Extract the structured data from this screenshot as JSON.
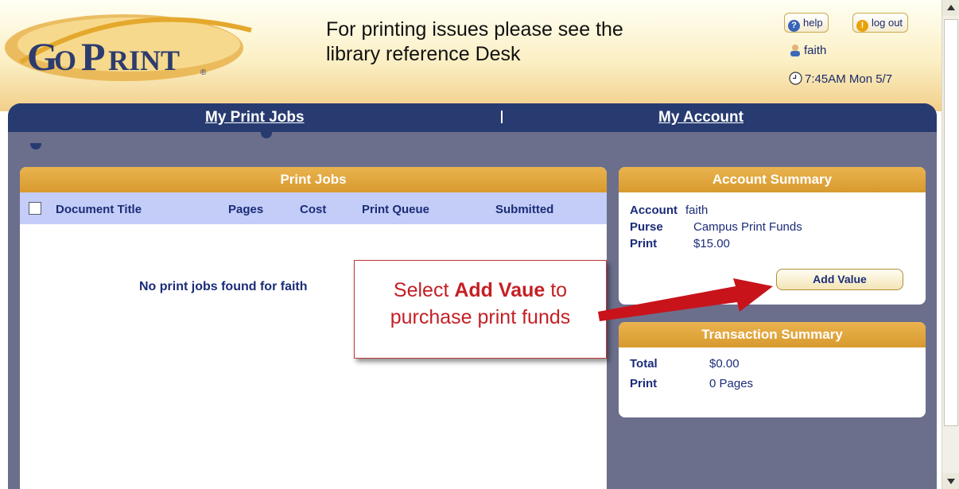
{
  "header": {
    "logo_text": "GoPrint",
    "message_line1": "For printing issues please see the",
    "message_line2": "library reference Desk",
    "help_label": "help",
    "logout_label": "log out",
    "username": "faith",
    "time": "7:45AM Mon 5/7"
  },
  "nav": {
    "print_jobs": "My Print Jobs",
    "separator": "|",
    "account": "My Account"
  },
  "print_jobs": {
    "title": "Print Jobs",
    "columns": [
      "Document Title",
      "Pages",
      "Cost",
      "Print Queue",
      "Submitted"
    ],
    "empty_message": "No print jobs found for faith"
  },
  "account_summary": {
    "title": "Account Summary",
    "account_label": "Account",
    "account_value": "faith",
    "purse_label": "Purse",
    "purse_value": "Campus Print Funds",
    "print_label": "Print",
    "print_value": "$15.00",
    "add_value_button": "Add Value"
  },
  "transaction_summary": {
    "title": "Transaction Summary",
    "total_label": "Total",
    "total_value": "$0.00",
    "print_label": "Print",
    "print_value": "0 Pages"
  },
  "callout": {
    "prefix": "Select ",
    "emphasis": "Add Vaue",
    "suffix": " to",
    "line2": "purchase print funds"
  },
  "colors": {
    "nav": "#273b70",
    "panel_header": "#d89a2e",
    "frame": "#6b6f8c",
    "column_header": "#c4cdf7",
    "callout": "#c42025"
  }
}
